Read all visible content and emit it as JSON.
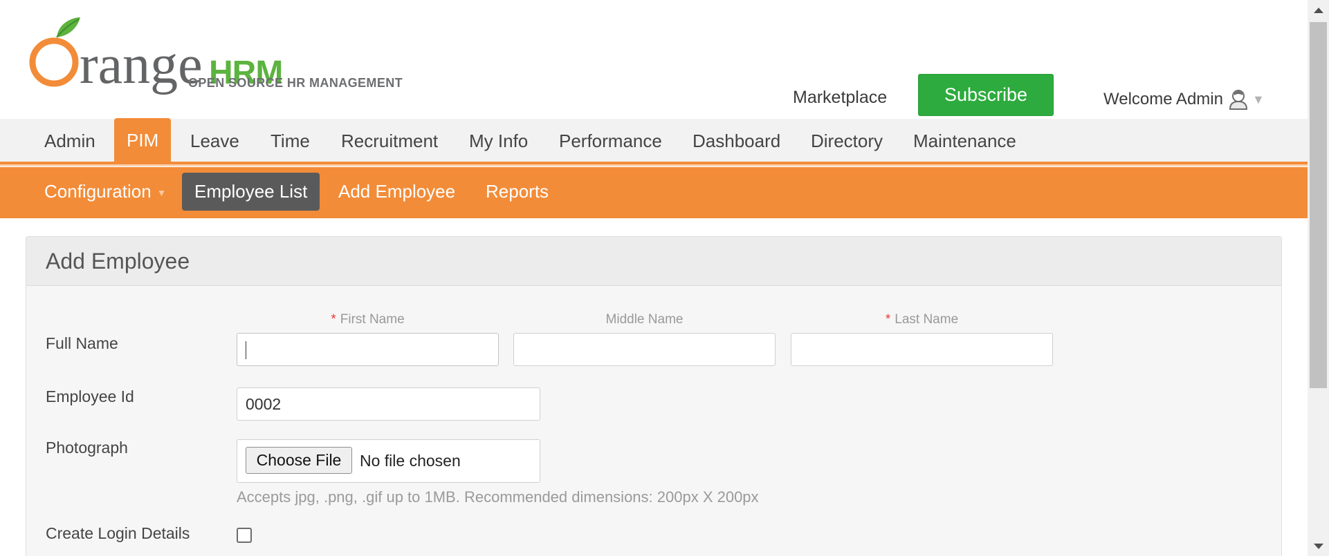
{
  "header": {
    "logo": {
      "word_orange": "range",
      "word_hrm": "HRM",
      "tagline": "OPEN SOURCE HR MANAGEMENT"
    },
    "marketplace_label": "Marketplace",
    "subscribe_label": "Subscribe",
    "welcome_text": "Welcome Admin"
  },
  "colors": {
    "brand_orange": "#f28c38",
    "subscribe_green": "#2dab3e",
    "active_submenu": "#5a5a5a",
    "required_marker": "#e63939"
  },
  "main_menu": {
    "items": [
      {
        "label": "Admin",
        "active": false
      },
      {
        "label": "PIM",
        "active": true
      },
      {
        "label": "Leave",
        "active": false
      },
      {
        "label": "Time",
        "active": false
      },
      {
        "label": "Recruitment",
        "active": false
      },
      {
        "label": "My Info",
        "active": false
      },
      {
        "label": "Performance",
        "active": false
      },
      {
        "label": "Dashboard",
        "active": false
      },
      {
        "label": "Directory",
        "active": false
      },
      {
        "label": "Maintenance",
        "active": false
      }
    ]
  },
  "sub_menu": {
    "items": [
      {
        "label": "Configuration",
        "has_dropdown": true,
        "active": false
      },
      {
        "label": "Employee List",
        "active": true
      },
      {
        "label": "Add Employee",
        "active": false
      },
      {
        "label": "Reports",
        "active": false
      }
    ]
  },
  "form": {
    "title": "Add Employee",
    "full_name_label": "Full Name",
    "first_name_label": "First Name",
    "middle_name_label": "Middle Name",
    "last_name_label": "Last Name",
    "required_marker": "*",
    "first_name_value": "",
    "middle_name_value": "",
    "last_name_value": "",
    "employee_id_label": "Employee Id",
    "employee_id_value": "0002",
    "photograph_label": "Photograph",
    "choose_file_label": "Choose File",
    "no_file_text": "No file chosen",
    "photo_help": "Accepts jpg, .png, .gif up to 1MB. Recommended dimensions: 200px X 200px",
    "create_login_label": "Create Login Details",
    "create_login_checked": false
  },
  "icons": {
    "user_avatar": "user-avatar-icon",
    "dropdown_caret": "caret-down-icon",
    "logo_orange": "orange-fruit-icon"
  }
}
